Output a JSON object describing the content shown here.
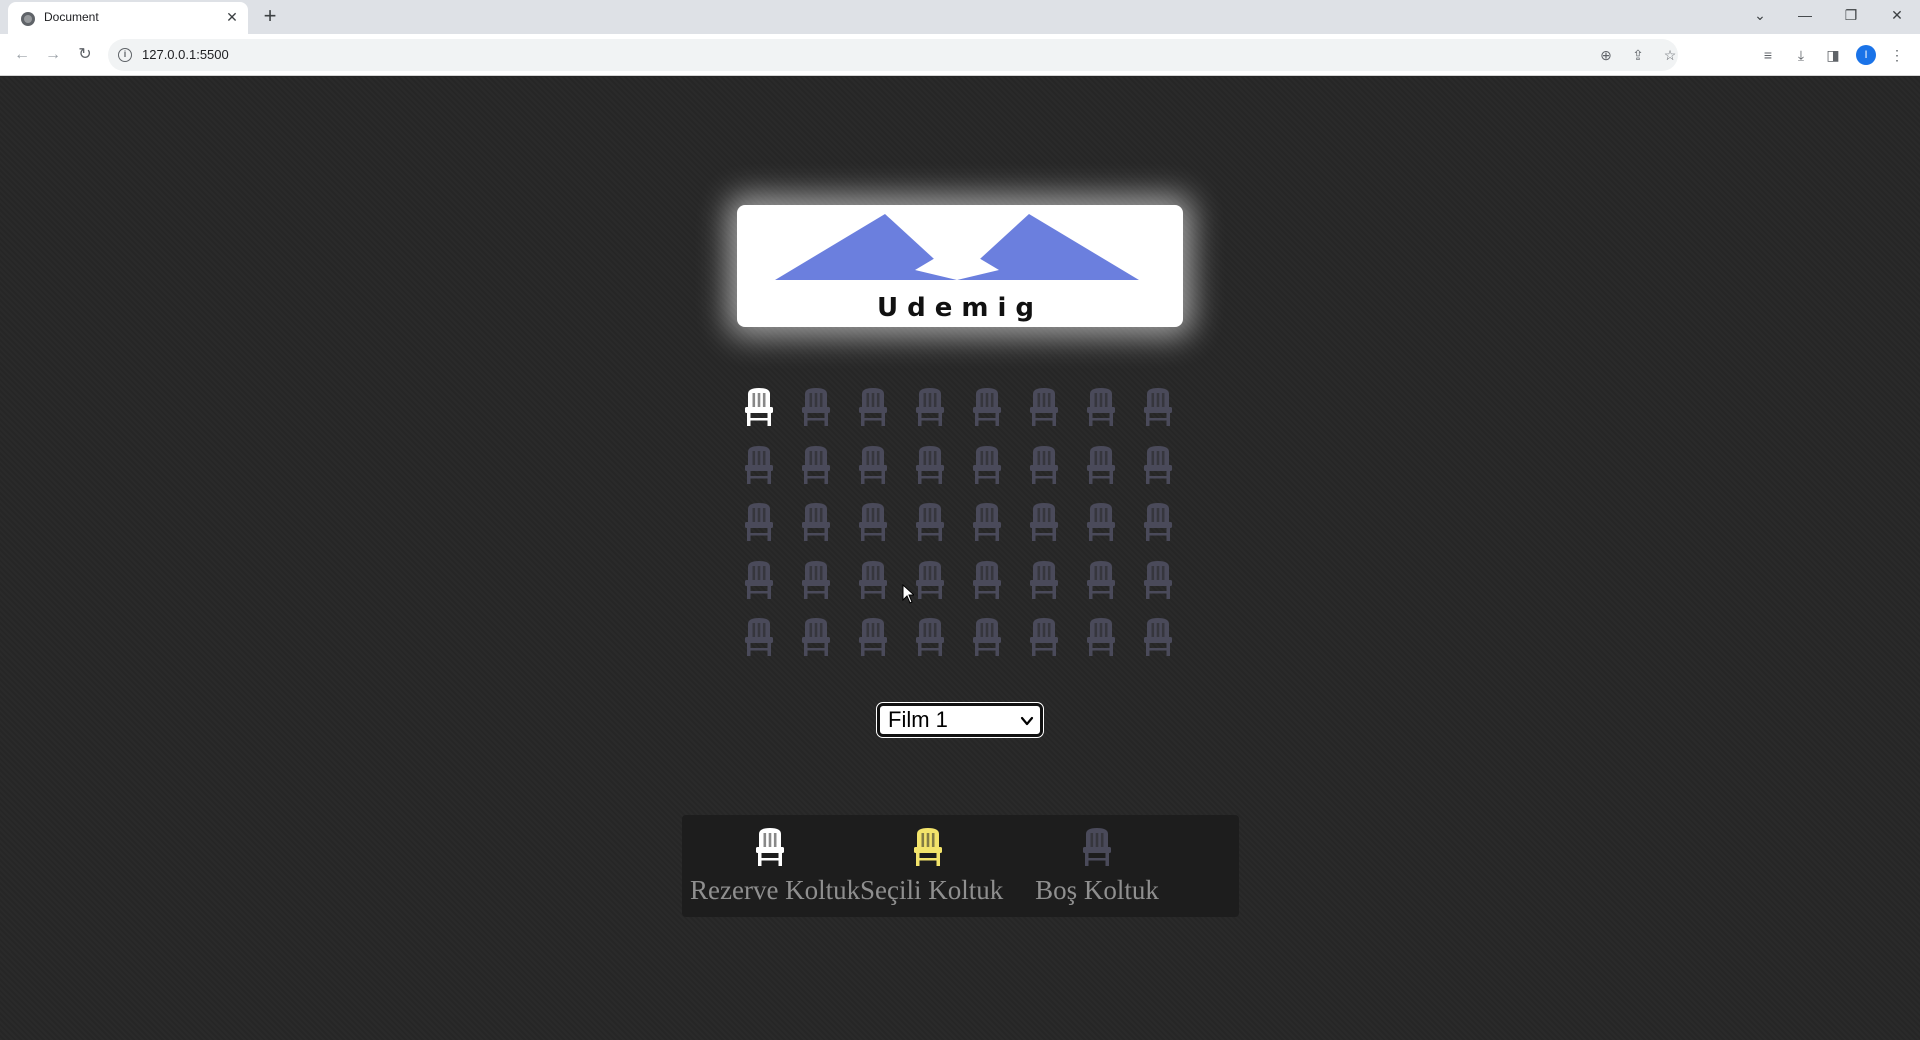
{
  "browser": {
    "tab_title": "Document",
    "tab_close": "✕",
    "new_tab": "+",
    "url": "127.0.0.1:5500",
    "profile_initial": "I",
    "window_controls": {
      "tab_search": "⌄",
      "minimize": "—",
      "restore": "❐",
      "close": "✕"
    }
  },
  "logo": {
    "text": "Udemig",
    "color": "#6b7fde"
  },
  "seats": {
    "rows": [
      [
        "reserved",
        "empty",
        "empty",
        "empty",
        "empty",
        "empty",
        "empty",
        "empty"
      ],
      [
        "empty",
        "empty",
        "empty",
        "empty",
        "empty",
        "empty",
        "empty",
        "empty"
      ],
      [
        "empty",
        "empty",
        "empty",
        "empty",
        "empty",
        "empty",
        "empty",
        "empty"
      ],
      [
        "empty",
        "empty",
        "empty",
        "empty",
        "empty",
        "empty",
        "empty",
        "empty"
      ],
      [
        "empty",
        "empty",
        "empty",
        "empty",
        "empty",
        "empty",
        "empty",
        "empty"
      ]
    ],
    "colors": {
      "reserved": "#ffffff",
      "selected": "#f3e46b",
      "empty": "#4a4a5a"
    }
  },
  "film_select": {
    "selected": "Film 1"
  },
  "legend": {
    "reserved_label": "Rezerve Koltuk",
    "selected_label": "Seçili Koltuk",
    "empty_label": "Boş Koltuk"
  }
}
